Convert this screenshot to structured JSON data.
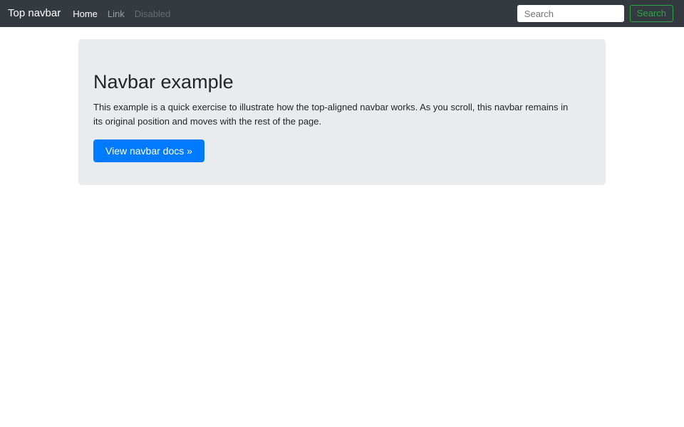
{
  "navbar": {
    "brand": "Top navbar",
    "items": [
      {
        "label": "Home",
        "state": "active"
      },
      {
        "label": "Link",
        "state": "normal"
      },
      {
        "label": "Disabled",
        "state": "disabled"
      }
    ],
    "search": {
      "placeholder": "Search",
      "value": "",
      "button_label": "Search"
    }
  },
  "jumbotron": {
    "title": "Navbar example",
    "description": "This example is a quick exercise to illustrate how the top-aligned navbar works. As you scroll, this navbar remains in its original position and moves with the rest of the page.",
    "cta_label": "View navbar docs »"
  },
  "colors": {
    "navbar_bg": "#343a40",
    "jumbotron_bg": "#e9ecef",
    "primary": "#007bff",
    "success": "#28a745",
    "text": "#212529",
    "page_bg": "#ffffff"
  }
}
